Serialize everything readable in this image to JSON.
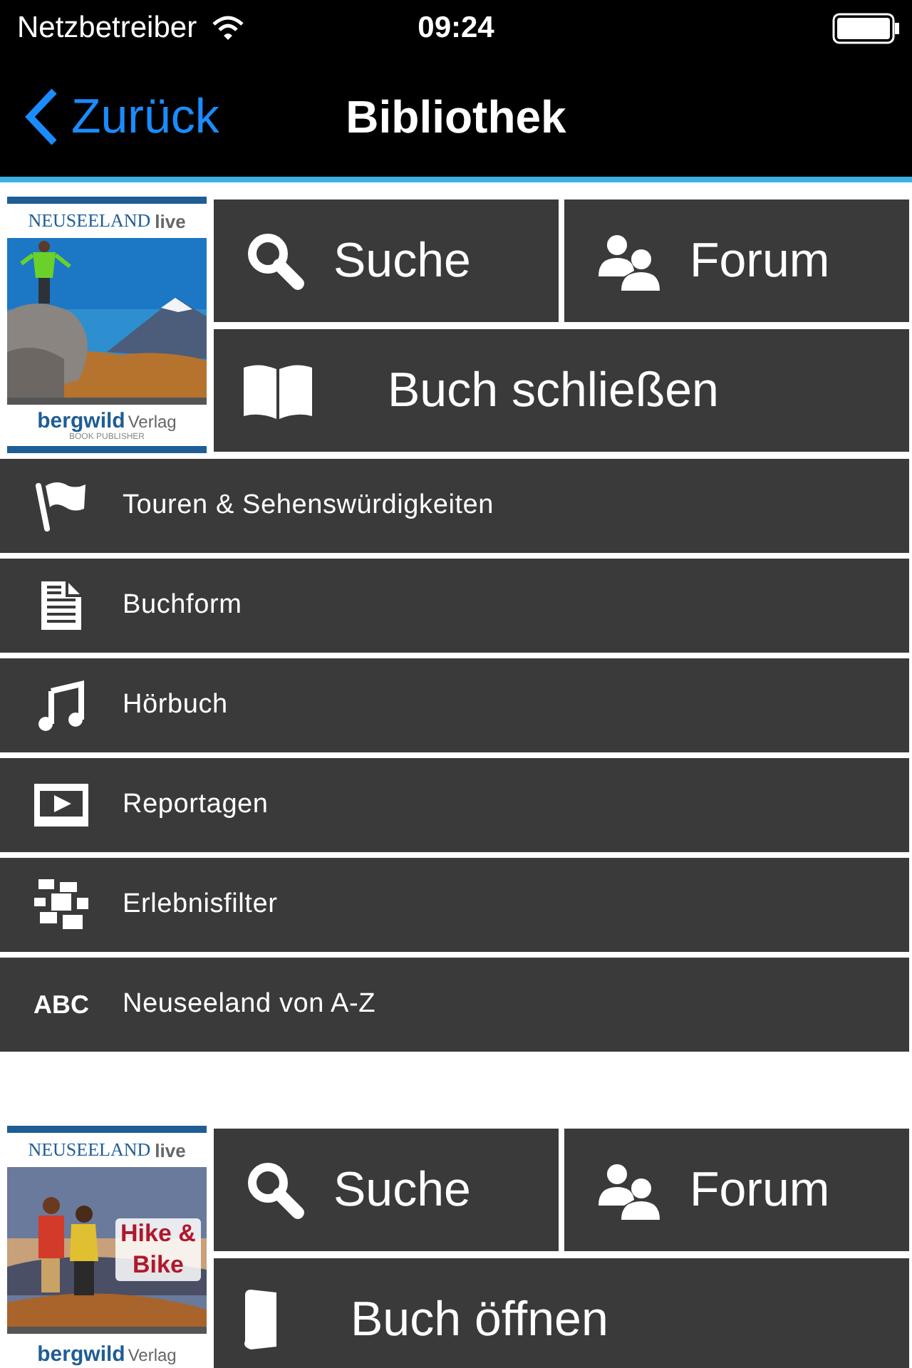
{
  "status_bar": {
    "carrier": "Netzbetreiber",
    "time": "09:24"
  },
  "nav": {
    "back": "Zurück",
    "title": "Bibliothek"
  },
  "books": [
    {
      "cover": {
        "series": "NEUSEELAND",
        "series_suffix": "live",
        "publisher": "bergwild",
        "publisher_suffix": "Verlag",
        "tagline": "BOOK PUBLISHER"
      },
      "actions": [
        {
          "kind": "search",
          "label": "Suche"
        },
        {
          "kind": "forum",
          "label": "Forum"
        },
        {
          "kind": "book-close",
          "label": "Buch schließen"
        }
      ],
      "menu": [
        {
          "kind": "flag",
          "label": "Touren & Sehenswürdigkeiten"
        },
        {
          "kind": "document",
          "label": "Buchform"
        },
        {
          "kind": "music",
          "label": "Hörbuch"
        },
        {
          "kind": "video",
          "label": "Reportagen"
        },
        {
          "kind": "filter",
          "label": "Erlebnisfilter"
        },
        {
          "kind": "abc",
          "icon_text": "ABC",
          "label": "Neuseeland von A-Z"
        }
      ]
    },
    {
      "cover": {
        "series": "NEUSEELAND",
        "series_suffix": "live",
        "badge": "Hike & Bike",
        "publisher": "bergwild",
        "publisher_suffix": "Verlag"
      },
      "actions": [
        {
          "kind": "search",
          "label": "Suche"
        },
        {
          "kind": "forum",
          "label": "Forum"
        },
        {
          "kind": "book-open",
          "label": "Buch öffnen"
        }
      ]
    }
  ]
}
